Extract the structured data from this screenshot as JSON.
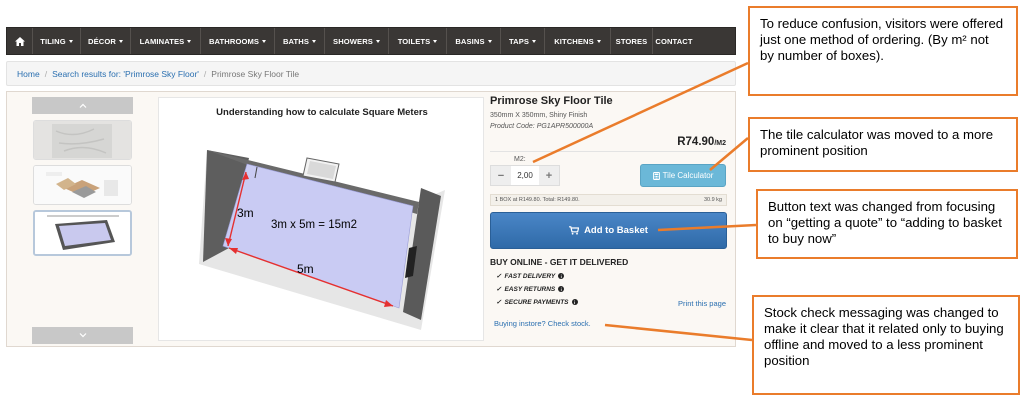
{
  "nav": {
    "items": [
      {
        "label": "TILING",
        "dropdown": true,
        "w": 48
      },
      {
        "label": "DÉCOR",
        "dropdown": true,
        "w": 50
      },
      {
        "label": "LAMINATES",
        "dropdown": true,
        "w": 70
      },
      {
        "label": "BATHROOMS",
        "dropdown": true,
        "w": 74
      },
      {
        "label": "BATHS",
        "dropdown": true,
        "w": 50
      },
      {
        "label": "SHOWERS",
        "dropdown": true,
        "w": 64
      },
      {
        "label": "TOILETS",
        "dropdown": true,
        "w": 58
      },
      {
        "label": "BASINS",
        "dropdown": true,
        "w": 54
      },
      {
        "label": "TAPS",
        "dropdown": true,
        "w": 44
      },
      {
        "label": "KITCHENS",
        "dropdown": true,
        "w": 66
      },
      {
        "label": "STORES",
        "dropdown": false,
        "w": 42
      },
      {
        "label": "CONTACT",
        "dropdown": false,
        "w": 42
      }
    ]
  },
  "breadcrumb": {
    "home": "Home",
    "search": "Search results for: 'Primrose Sky Floor'",
    "current": "Primrose Sky Floor Tile"
  },
  "image": {
    "title": "Understanding how to calculate Square Meters",
    "dim_height": "3m",
    "dim_width": "5m",
    "formula": "3m x 5m = 15m2"
  },
  "product": {
    "title": "Primrose Sky Floor Tile",
    "size": "350mm X 350mm, Shiny Finish",
    "code": "Product Code: PG1APR500000A",
    "price": "R74.90",
    "price_unit": "/M2",
    "qty_label": "M2:",
    "qty_value": "2,00",
    "minus": "−",
    "plus": "+",
    "calc_label": "Tile Calculator",
    "box_info": "1 BOX at R149.80. Total: R149.80.",
    "weight": "30.9 kg",
    "basket_label": "Add to Basket",
    "buy_title": "BUY ONLINE - GET IT DELIVERED",
    "features": [
      "FAST DELIVERY",
      "EASY RETURNS",
      "SECURE PAYMENTS"
    ],
    "print_label": "Print this page",
    "stock_label": "Buying instore? Check stock."
  },
  "annotations": [
    "To reduce confusion, visitors were offered just one method of ordering. (By m² not by number of boxes).",
    "The tile calculator was moved to a more prominent position",
    "Button text was changed from focusing on “getting a quote” to “adding to basket to buy now”",
    "Stock check messaging was changed to make it clear that it related only to buying offline and moved to a less prominent position"
  ],
  "colors": {
    "accent_orange": "#ea7c2b",
    "nav_bg": "#3a3735",
    "basket_blue": "#2f6aa8",
    "calc_blue": "#6bb8d8",
    "link_blue": "#2a6fb0"
  }
}
